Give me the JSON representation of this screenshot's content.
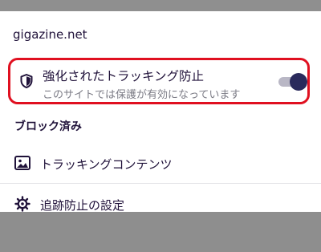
{
  "panel": {
    "site": "gigazine.net",
    "etp": {
      "title": "強化されたトラッキング防止",
      "subtitle": "このサイトでは保護が有効になっています",
      "enabled": true
    },
    "blocked": {
      "header": "ブロック済み",
      "items": [
        {
          "label": "トラッキングコンテンツ",
          "icon": "image-icon"
        }
      ]
    },
    "settings": {
      "label": "追跡防止の設定",
      "icon": "gear-icon"
    }
  },
  "colors": {
    "highlight_border": "#e01020",
    "toggle_thumb": "#2a2a5c",
    "toggle_track": "#b9b7c5",
    "text_primary": "#20123a",
    "text_secondary": "#7c7c86",
    "scrim": "#8e8e8e"
  }
}
